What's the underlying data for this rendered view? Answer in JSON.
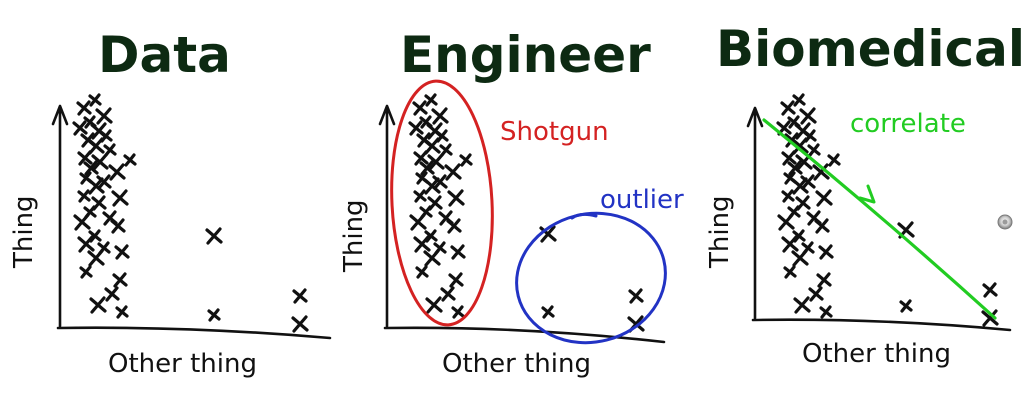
{
  "panels": [
    {
      "title": "Data",
      "x_label": "Other thing",
      "y_label": "Thing",
      "annotations": []
    },
    {
      "title": "Engineer",
      "x_label": "Other thing",
      "y_label": "Thing",
      "annotations": [
        {
          "text": "Shotgun",
          "color": "#d42222"
        },
        {
          "text": "outlier",
          "color": "#2233c4"
        }
      ]
    },
    {
      "title": "Biomedical",
      "x_label": "Other thing",
      "y_label": "Thing",
      "annotations": [
        {
          "text": "correlate",
          "color": "#22cc22"
        }
      ]
    }
  ],
  "colors": {
    "ink": "#111111",
    "title_ink": "#0d2a12",
    "shotgun": "#d42222",
    "outlier": "#2233c4",
    "correlate": "#22cc22"
  },
  "icons": [
    "cursor-dot-icon"
  ]
}
